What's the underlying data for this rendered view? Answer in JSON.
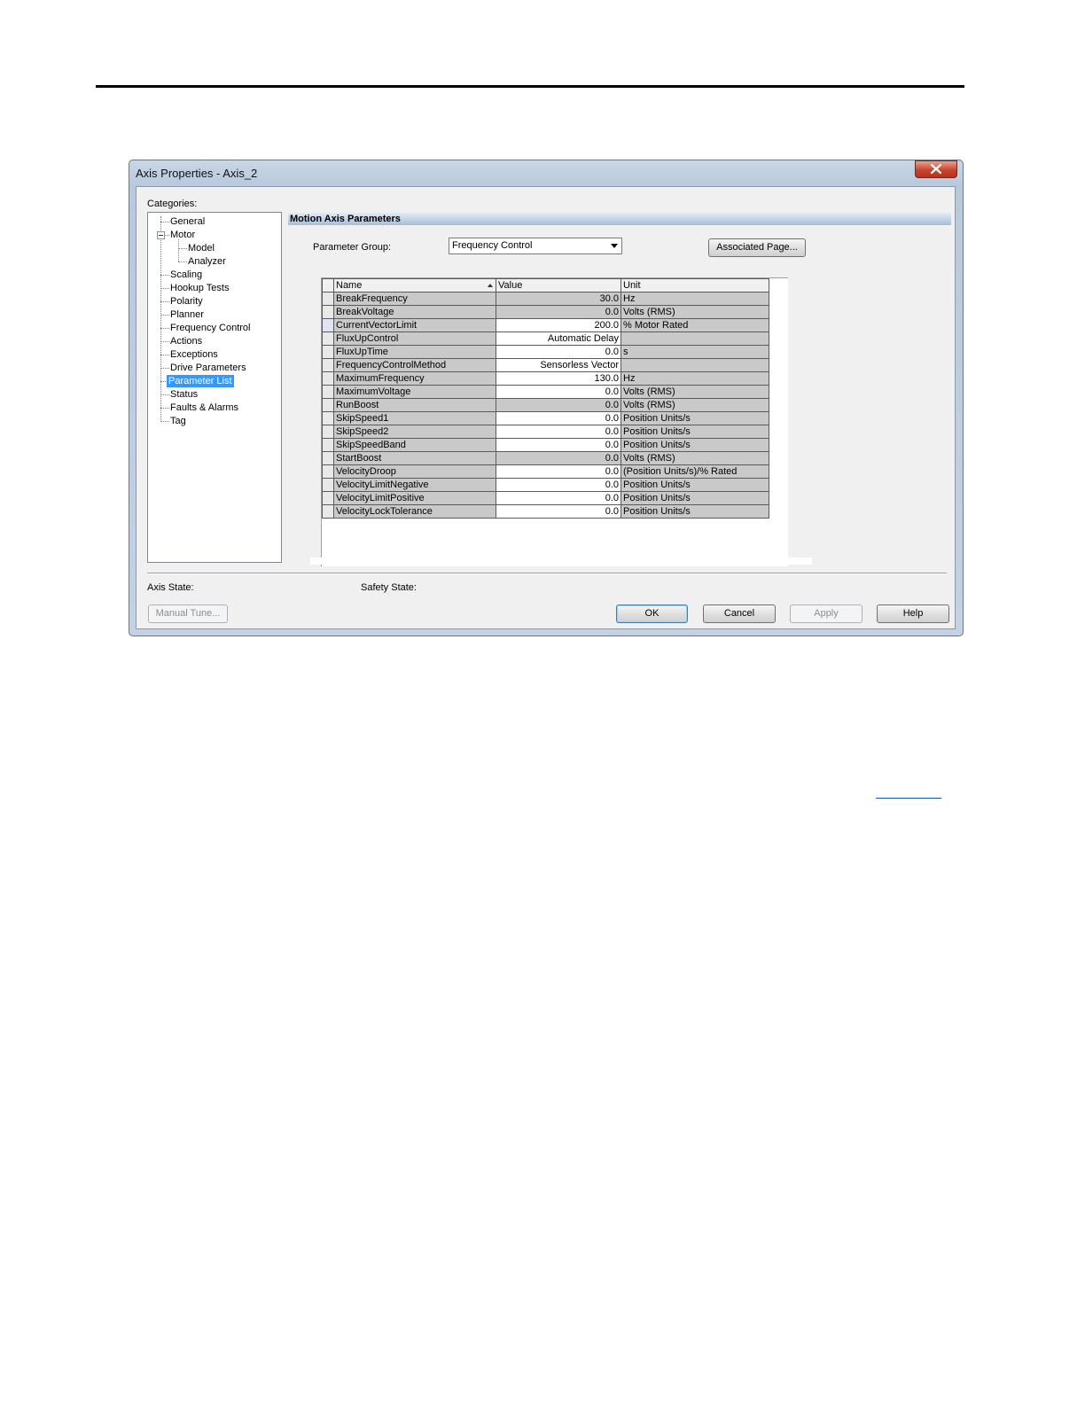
{
  "window": {
    "title": "Axis Properties - Axis_2"
  },
  "categories": {
    "label": "Categories:",
    "items": [
      {
        "label": "General"
      },
      {
        "label": "Motor"
      },
      {
        "label": "Model"
      },
      {
        "label": "Analyzer"
      },
      {
        "label": "Scaling"
      },
      {
        "label": "Hookup Tests"
      },
      {
        "label": "Polarity"
      },
      {
        "label": "Planner"
      },
      {
        "label": "Frequency Control"
      },
      {
        "label": "Actions"
      },
      {
        "label": "Exceptions"
      },
      {
        "label": "Drive Parameters"
      },
      {
        "label": "Parameter List"
      },
      {
        "label": "Status"
      },
      {
        "label": "Faults & Alarms"
      },
      {
        "label": "Tag"
      }
    ],
    "selected": "Parameter List"
  },
  "main": {
    "section_title": "Motion Axis Parameters",
    "parameter_group_label": "Parameter Group:",
    "parameter_group_value": "Frequency Control",
    "associated_page_button": "Associated Page..."
  },
  "grid": {
    "headers": {
      "name": "Name",
      "value": "Value",
      "unit": "Unit"
    },
    "rows": [
      {
        "name": "BreakFrequency",
        "value": "30.0",
        "unit": "Hz"
      },
      {
        "name": "BreakVoltage",
        "value": "0.0",
        "unit": "Volts (RMS)"
      },
      {
        "name": "CurrentVectorLimit",
        "value": "200.0",
        "unit": "% Motor Rated"
      },
      {
        "name": "FluxUpControl",
        "value": "Automatic Delay",
        "unit": ""
      },
      {
        "name": "FluxUpTime",
        "value": "0.0",
        "unit": "s"
      },
      {
        "name": "FrequencyControlMethod",
        "value": "Sensorless Vector",
        "unit": ""
      },
      {
        "name": "MaximumFrequency",
        "value": "130.0",
        "unit": "Hz"
      },
      {
        "name": "MaximumVoltage",
        "value": "0.0",
        "unit": "Volts (RMS)"
      },
      {
        "name": "RunBoost",
        "value": "0.0",
        "unit": "Volts (RMS)"
      },
      {
        "name": "SkipSpeed1",
        "value": "0.0",
        "unit": "Position Units/s"
      },
      {
        "name": "SkipSpeed2",
        "value": "0.0",
        "unit": "Position Units/s"
      },
      {
        "name": "SkipSpeedBand",
        "value": "0.0",
        "unit": "Position Units/s"
      },
      {
        "name": "StartBoost",
        "value": "0.0",
        "unit": "Volts (RMS)"
      },
      {
        "name": "VelocityDroop",
        "value": "0.0",
        "unit": "(Position Units/s)/% Rated"
      },
      {
        "name": "VelocityLimitNegative",
        "value": "0.0",
        "unit": "Position Units/s"
      },
      {
        "name": "VelocityLimitPositive",
        "value": "0.0",
        "unit": "Position Units/s"
      },
      {
        "name": "VelocityLockTolerance",
        "value": "0.0",
        "unit": "Position Units/s"
      }
    ]
  },
  "footer": {
    "axis_state_label": "Axis State:",
    "safety_state_label": "Safety State:",
    "manual_tune_button": "Manual Tune...",
    "ok_button": "OK",
    "cancel_button": "Cancel",
    "apply_button": "Apply",
    "help_button": "Help"
  },
  "colors": {
    "selection": "#3399ff",
    "readonly_cell": "#c9c9c9",
    "close_button": "#c7452e"
  }
}
